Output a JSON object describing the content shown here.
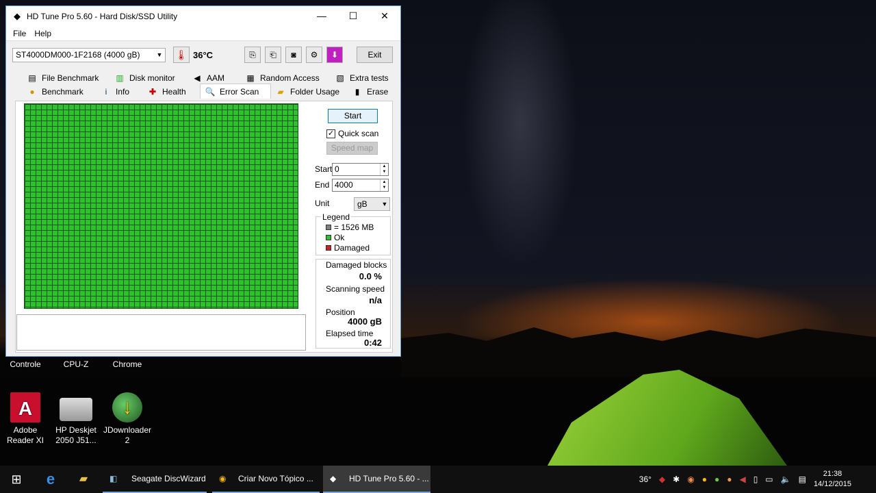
{
  "window": {
    "title": "HD Tune Pro 5.60 - Hard Disk/SSD Utility",
    "minimize": "—",
    "maximize": "☐",
    "close": "✕"
  },
  "menu": [
    "File",
    "Help"
  ],
  "toolbar": {
    "drive": "ST4000DM000-1F2168 (4000 gB)",
    "temperature": "36°C",
    "exit_label": "Exit"
  },
  "tabs": {
    "row1": [
      {
        "label": "File Benchmark",
        "icon": "file-benchmark-icon"
      },
      {
        "label": "Disk monitor",
        "icon": "disk-monitor-icon"
      },
      {
        "label": "AAM",
        "icon": "speaker-icon"
      },
      {
        "label": "Random Access",
        "icon": "random-access-icon"
      },
      {
        "label": "Extra tests",
        "icon": "extra-tests-icon"
      }
    ],
    "row2": [
      {
        "label": "Benchmark",
        "icon": "bulb-icon"
      },
      {
        "label": "Info",
        "icon": "info-icon"
      },
      {
        "label": "Health",
        "icon": "health-cross-icon"
      },
      {
        "label": "Error Scan",
        "icon": "magnifier-icon"
      },
      {
        "label": "Folder Usage",
        "icon": "folder-icon"
      },
      {
        "label": "Erase",
        "icon": "trash-icon"
      }
    ],
    "active": "Error Scan"
  },
  "scan": {
    "start_label": "Start",
    "quick_scan_label": "Quick scan",
    "quick_scan_checked": true,
    "speed_map_label": "Speed map",
    "start_field_label": "Start",
    "start_value": "0",
    "end_field_label": "End",
    "end_value": "4000",
    "unit_label": "Unit",
    "unit_value": "gB"
  },
  "legend": {
    "title": "Legend",
    "block": "= 1526 MB",
    "ok": "Ok",
    "damaged": "Damaged",
    "colors": {
      "block": "#808080",
      "ok": "#2ec02e",
      "damaged": "#d02020"
    }
  },
  "stats": {
    "damaged_label": "Damaged blocks",
    "damaged_value": "0.0 %",
    "speed_label": "Scanning speed",
    "speed_value": "n/a",
    "position_label": "Position",
    "position_value": "4000 gB",
    "elapsed_label": "Elapsed time",
    "elapsed_value": "0:42"
  },
  "desktop": {
    "partial_labels": [
      "Controle",
      "CPU-Z",
      "Chrome"
    ],
    "icons": [
      {
        "label": "Adobe Reader XI",
        "icon": "adobe-reader-icon"
      },
      {
        "label": "HP Deskjet 2050 J51...",
        "icon": "printer-icon"
      },
      {
        "label": "JDownloader 2",
        "icon": "jdownloader-icon"
      }
    ]
  },
  "taskbar": {
    "apps": [
      {
        "label": "Seagate DiscWizard",
        "icon": "discwizard-icon"
      },
      {
        "label": "Criar Novo Tópico ...",
        "icon": "chrome-icon"
      },
      {
        "label": "HD Tune Pro 5.60 - ...",
        "icon": "hdtune-icon"
      }
    ],
    "tray_temp": "36°",
    "time": "21:38",
    "date": "14/12/2015"
  }
}
